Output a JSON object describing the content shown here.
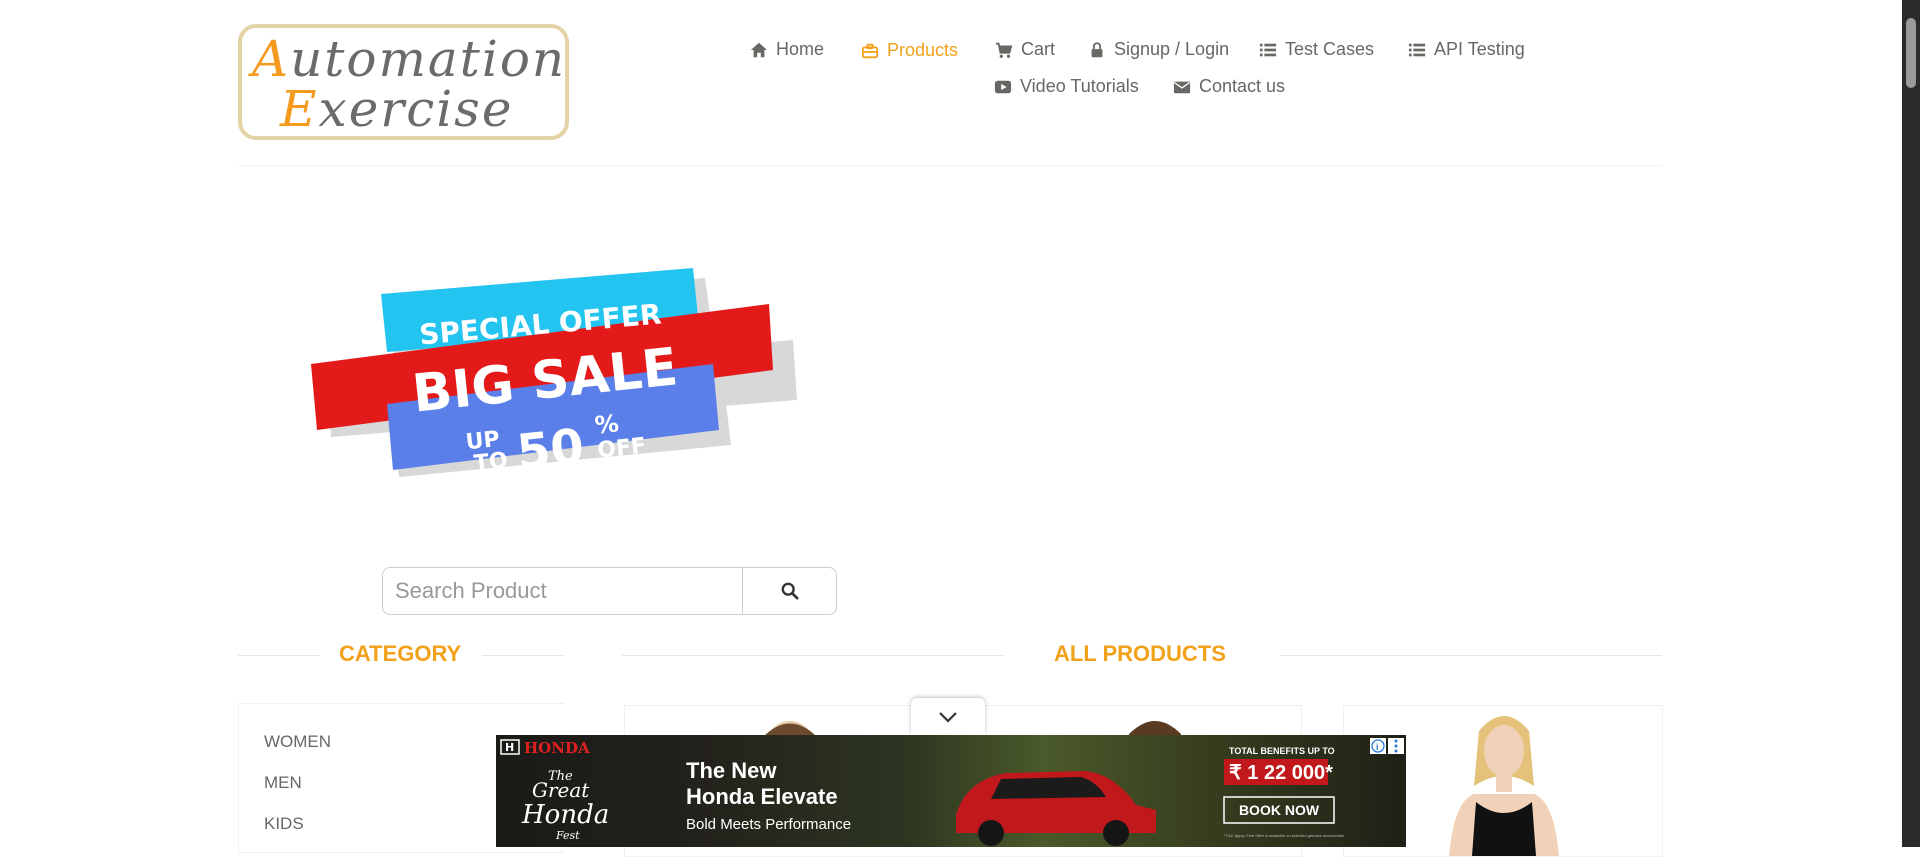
{
  "logo": {
    "line1_cap": "A",
    "line1_rest": "utomation",
    "line2_cap": "E",
    "line2_rest": "xercise"
  },
  "nav": {
    "home": "Home",
    "products": "Products",
    "cart": "Cart",
    "signup_login": "Signup / Login",
    "test_cases": "Test Cases",
    "api_testing": "API Testing",
    "video_tutorials": "Video Tutorials",
    "contact_us": "Contact us"
  },
  "banner": {
    "special_offer": "SPECIAL OFFER",
    "big_sale": "BIG SALE",
    "up": "UP",
    "to": "TO",
    "fifty": "50",
    "percent": "%",
    "off": "OFF"
  },
  "search": {
    "placeholder": "Search Product"
  },
  "sections": {
    "category": "CATEGORY",
    "all_products": "ALL PRODUCTS"
  },
  "categories": [
    "WOMEN",
    "MEN",
    "KIDS"
  ],
  "ad": {
    "brand": "HONDA",
    "fest_the": "The",
    "fest_great": "Great",
    "fest_honda": "Honda",
    "fest_fest": "Fest",
    "headline1": "The New",
    "headline2": "Honda Elevate",
    "tagline": "Bold Meets Performance",
    "benefits_label": "TOTAL BENEFITS UP TO",
    "benefits_value": "₹ 1 22 000*",
    "cta": "BOOK NOW",
    "fine_print": "*T&C Apply. Fest Offer is available on selected genuine accessories."
  },
  "colors": {
    "accent": "#f2a11a",
    "text": "#696763",
    "banner_red": "#e41a1a",
    "banner_cyan": "#23c4ef",
    "banner_blue": "#5b7fe8"
  }
}
